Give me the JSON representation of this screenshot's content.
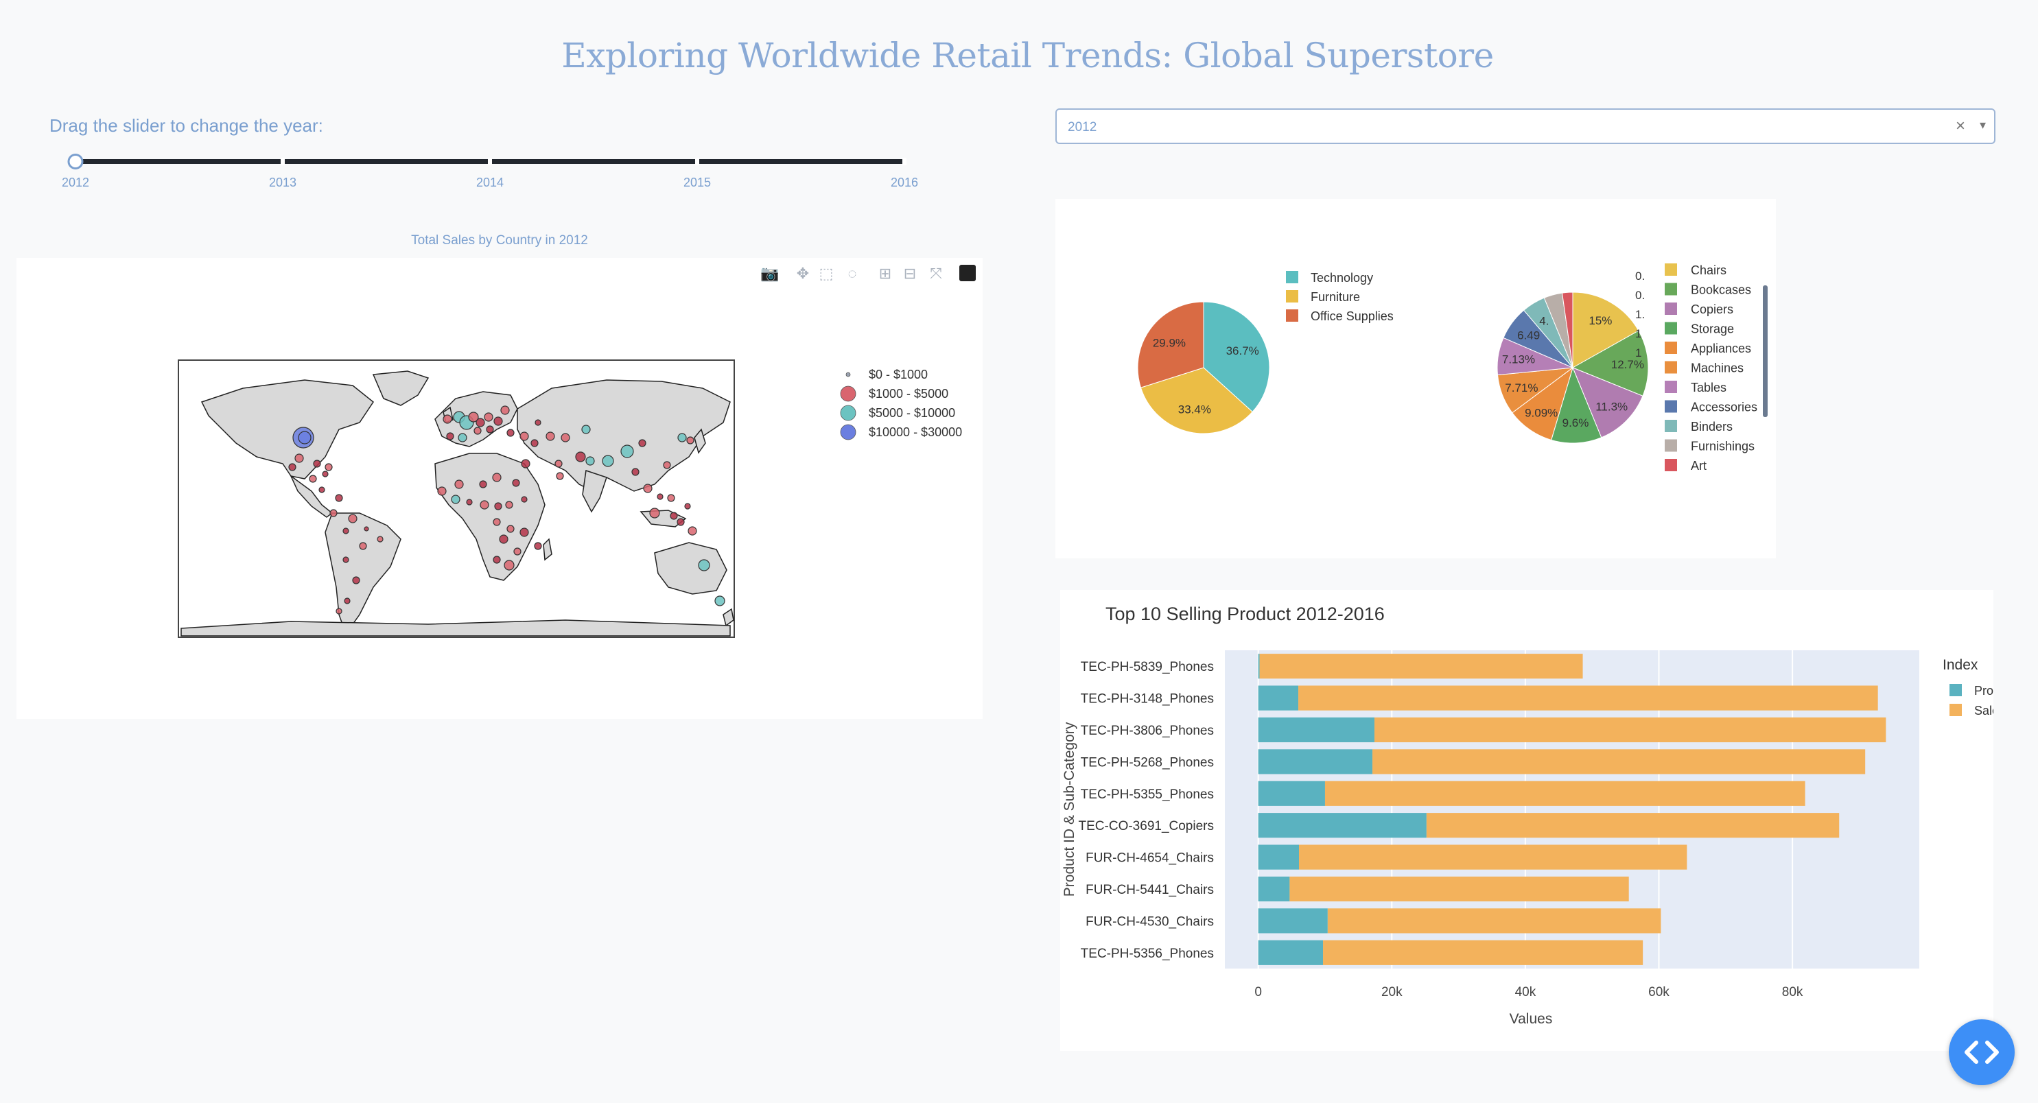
{
  "app": {
    "title": "Exploring Worldwide Retail Trends: Global Superstore"
  },
  "slider": {
    "label": "Drag the slider to change the year:",
    "marks": [
      "2012",
      "2013",
      "2014",
      "2015",
      "2016"
    ],
    "selected": "2012"
  },
  "dropdown": {
    "value": "2012",
    "clear_icon": "close-icon",
    "caret_icon": "chevron-down-icon"
  },
  "map_chart": {
    "title": "Total Sales by Country in 2012",
    "toolbar": [
      "camera-icon",
      "pan-icon",
      "box-select-icon",
      "lasso-select-icon",
      "zoom-in-icon",
      "zoom-out-icon",
      "reset-view-icon",
      "plotly-logo-icon"
    ],
    "legend": [
      {
        "label": "$0 - $1000",
        "color": "#9aa2b0"
      },
      {
        "label": "$1000 - $5000",
        "color": "#d9656f"
      },
      {
        "label": "$5000 - $10000",
        "color": "#6cc3c1"
      },
      {
        "label": "$10000 - $30000",
        "color": "#6b7fe0"
      }
    ]
  },
  "colors": {
    "accent": "#8aaad6",
    "technology": "#5bbec0",
    "furniture": "#ebbd45",
    "office_supplies": "#d96b44",
    "profit": "#5ab2c0",
    "sales": "#f3b25c",
    "plot_bg": "#e5ebf6"
  },
  "chart_data": [
    {
      "type": "pie",
      "labels": [
        "Technology",
        "Furniture",
        "Office Supplies"
      ],
      "values": [
        36.7,
        33.4,
        29.9
      ],
      "slice_labels": [
        "36.7%",
        "33.4%",
        "29.9%"
      ],
      "colors": [
        "#5bbec0",
        "#ebbd45",
        "#d96b44"
      ]
    },
    {
      "type": "pie",
      "labels": [
        "Chairs",
        "Bookcases",
        "Copiers",
        "Storage",
        "Appliances",
        "Machines",
        "Tables",
        "Accessories",
        "Binders",
        "Furnishings",
        "Art"
      ],
      "values": [
        15,
        12.7,
        11.3,
        9.6,
        9.09,
        7.71,
        7.13,
        6.49,
        4.5,
        3.5,
        2.0
      ],
      "slice_labels": [
        "15%",
        "12.7%",
        "11.3%",
        "9.6%",
        "9.09%",
        "7.71%",
        "7.13%",
        "6.49",
        "4.",
        "",
        ""
      ],
      "truncated_labels": [
        "0.",
        "0.",
        "1.",
        "1",
        "1"
      ],
      "colors": [
        "#e8c24e",
        "#68a85a",
        "#b07cb0",
        "#5aa860",
        "#ea8c3c",
        "#e98f3e",
        "#b57fb6",
        "#5a78ad",
        "#7fb9b8",
        "#b8aea8",
        "#d9565e"
      ]
    },
    {
      "type": "bar",
      "title": "Top 10 Selling Product 2012-2016",
      "orientation": "horizontal",
      "categories": [
        "TEC-PH-5839_Phones",
        "TEC-PH-3148_Phones",
        "TEC-PH-3806_Phones",
        "TEC-PH-5268_Phones",
        "TEC-PH-5355_Phones",
        "TEC-CO-3691_Copiers",
        "FUR-CH-4654_Chairs",
        "FUR-CH-5441_Chairs",
        "FUR-CH-4530_Chairs",
        "TEC-PH-5356_Phones"
      ],
      "series": [
        {
          "name": "Profit",
          "values": [
            200,
            6000,
            17400,
            17100,
            10000,
            25200,
            6100,
            4700,
            10400,
            9700
          ]
        },
        {
          "name": "Sales",
          "values": [
            48400,
            86800,
            76600,
            73800,
            71900,
            61800,
            58100,
            50800,
            49900,
            47900
          ]
        }
      ],
      "stacked": true,
      "xlabel": "Values",
      "ylabel": "Product ID & Sub-Category",
      "legend_title": "Index",
      "xlim": [
        -5000,
        99000
      ],
      "xticks": [
        0,
        20000,
        40000,
        60000,
        80000
      ],
      "xtick_labels": [
        "0",
        "20k",
        "40k",
        "60k",
        "80k"
      ],
      "grid": true,
      "legend": "right"
    }
  ]
}
